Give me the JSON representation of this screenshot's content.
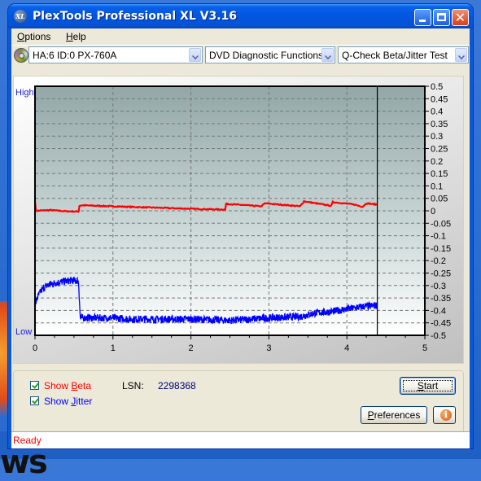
{
  "window": {
    "title": "PlexTools Professional XL V3.16",
    "app_icon_text": "XL",
    "controls": {
      "minimize": "minimize-icon",
      "maximize": "maximize-icon",
      "close": "close-icon",
      "close_glyph": "✕"
    }
  },
  "menu": {
    "items": [
      {
        "label": "Options",
        "accel": "O",
        "rest": "ptions"
      },
      {
        "label": "Help",
        "accel": "H",
        "rest": "elp"
      }
    ]
  },
  "toolbar": {
    "drive": "HA:6 ID:0  PX-760A",
    "function": "DVD Diagnostic Functions",
    "test": "Q-Check Beta/Jitter Test"
  },
  "chart_labels": {
    "high": "High",
    "low": "Low"
  },
  "chart_data": {
    "type": "line",
    "title": "",
    "xlabel": "",
    "ylabel": "",
    "xlim": [
      0,
      5
    ],
    "ylim": [
      -0.5,
      0.5
    ],
    "x_ticks": [
      "0",
      "1",
      "2",
      "3",
      "4",
      "5"
    ],
    "y_ticks": [
      "0.5",
      "0.45",
      "0.4",
      "0.35",
      "0.3",
      "0.25",
      "0.2",
      "0.15",
      "0.1",
      "0.05",
      "0",
      "-0.05",
      "-0.1",
      "-0.15",
      "-0.2",
      "-0.25",
      "-0.3",
      "-0.35",
      "-0.4",
      "-0.45",
      "-0.5"
    ],
    "grid": true,
    "end_marker_x": 4.39,
    "series": [
      {
        "name": "Beta",
        "color": "#ff0000",
        "x": [
          0.0,
          0.01,
          0.02,
          0.2,
          0.4,
          0.56,
          0.57,
          0.6,
          1.0,
          1.5,
          2.0,
          2.44,
          2.45,
          2.9,
          2.95,
          3.4,
          3.45,
          3.8,
          3.82,
          4.1,
          4.2,
          4.25,
          4.39
        ],
        "y": [
          0.04,
          0.0,
          0.0,
          0.003,
          -0.002,
          -0.003,
          0.02,
          0.022,
          0.018,
          0.013,
          0.008,
          0.005,
          0.028,
          0.018,
          0.03,
          0.018,
          0.038,
          0.02,
          0.035,
          0.025,
          0.016,
          0.03,
          0.025
        ]
      },
      {
        "name": "Jitter",
        "color": "#0000ff",
        "x": [
          0.0,
          0.03,
          0.08,
          0.15,
          0.25,
          0.35,
          0.45,
          0.55,
          0.56,
          0.58,
          0.8,
          1.0,
          1.2,
          1.5,
          2.0,
          2.5,
          3.0,
          3.4,
          3.6,
          3.8,
          4.0,
          4.2,
          4.39
        ],
        "y": [
          -0.38,
          -0.35,
          -0.32,
          -0.3,
          -0.29,
          -0.285,
          -0.28,
          -0.28,
          -0.29,
          -0.43,
          -0.43,
          -0.43,
          -0.435,
          -0.435,
          -0.435,
          -0.44,
          -0.43,
          -0.425,
          -0.41,
          -0.405,
          -0.395,
          -0.385,
          -0.38
        ]
      }
    ]
  },
  "controls": {
    "show_beta": {
      "label": "Show Beta",
      "pre": "Show ",
      "accel": "B",
      "rest": "eta",
      "checked": true,
      "color": "#ff0000"
    },
    "show_jitter": {
      "label": "Show Jitter",
      "pre": "Show ",
      "accel": "J",
      "rest": "itter",
      "checked": true,
      "color": "#0000ff"
    },
    "lsn_label": "LSN:",
    "lsn_value": "2298368",
    "start": {
      "label": "Start",
      "accel": "S",
      "rest": "tart"
    },
    "preferences": {
      "label": "Preferences",
      "accel": "P",
      "rest": "references"
    },
    "info_glyph": "i"
  },
  "status": {
    "text": "Ready"
  }
}
